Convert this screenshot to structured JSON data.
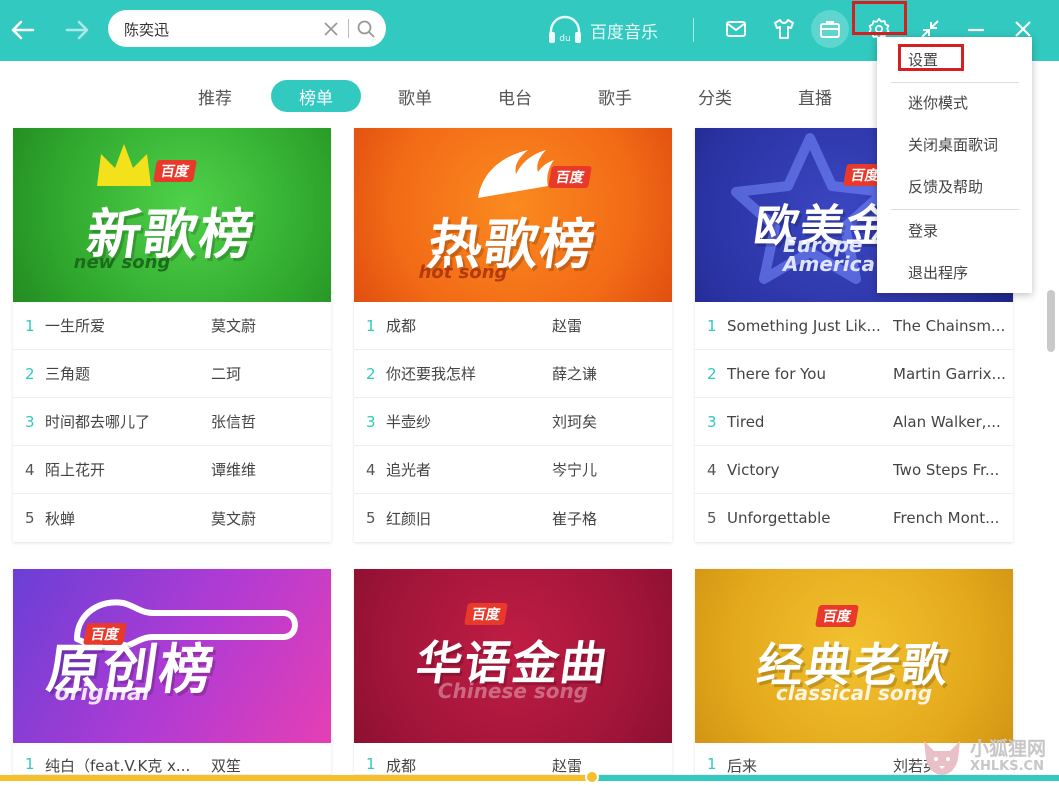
{
  "colors": {
    "accent": "#31c9c0",
    "highlight": "#d42020",
    "progress": "#f6c02c"
  },
  "search": {
    "value": "陈奕迅"
  },
  "header": {
    "brand": "百度音乐"
  },
  "tabs": [
    {
      "label": "推荐"
    },
    {
      "label": "榜单"
    },
    {
      "label": "歌单"
    },
    {
      "label": "电台"
    },
    {
      "label": "歌手"
    },
    {
      "label": "分类"
    },
    {
      "label": "直播"
    }
  ],
  "active_tab": "榜单",
  "charts": [
    {
      "badge": "百度",
      "name": "新歌榜",
      "subtitle": "new song",
      "songs": [
        {
          "rank": "1",
          "title": "一生所爱",
          "artist": "莫文蔚"
        },
        {
          "rank": "2",
          "title": "三角题",
          "artist": "二珂"
        },
        {
          "rank": "3",
          "title": "时间都去哪儿了",
          "artist": "张信哲"
        },
        {
          "rank": "4",
          "title": "陌上花开",
          "artist": "谭维维"
        },
        {
          "rank": "5",
          "title": "秋蝉",
          "artist": "莫文蔚"
        }
      ]
    },
    {
      "badge": "百度",
      "name": "热歌榜",
      "subtitle": "hot song",
      "songs": [
        {
          "rank": "1",
          "title": "成都",
          "artist": "赵雷"
        },
        {
          "rank": "2",
          "title": "你还要我怎样",
          "artist": "薛之谦"
        },
        {
          "rank": "3",
          "title": "半壶纱",
          "artist": "刘珂矣"
        },
        {
          "rank": "4",
          "title": "追光者",
          "artist": "岑宁儿"
        },
        {
          "rank": "5",
          "title": "红颜旧",
          "artist": "崔子格"
        }
      ]
    },
    {
      "badge": "百度",
      "name": "欧美金",
      "subtitle": "Europe America",
      "songs": [
        {
          "rank": "1",
          "title": "Something Just Lik...",
          "artist": "The Chainsm..."
        },
        {
          "rank": "2",
          "title": "There for You",
          "artist": "Martin Garrix..."
        },
        {
          "rank": "3",
          "title": "Tired",
          "artist": "Alan Walker,..."
        },
        {
          "rank": "4",
          "title": "Victory",
          "artist": "Two Steps Fr..."
        },
        {
          "rank": "5",
          "title": "Unforgettable",
          "artist": "French Mont..."
        }
      ]
    },
    {
      "badge": "百度",
      "name": "原创榜",
      "subtitle": "original",
      "songs": [
        {
          "rank": "1",
          "title": "纯白（feat.V.K克 x...",
          "artist": "双笙"
        }
      ]
    },
    {
      "badge": "百度",
      "name": "华语金曲",
      "subtitle": "Chinese song",
      "songs": [
        {
          "rank": "1",
          "title": "成都",
          "artist": "赵雷"
        }
      ]
    },
    {
      "badge": "百度",
      "name": "经典老歌",
      "subtitle": "classical song",
      "songs": [
        {
          "rank": "1",
          "title": "后来",
          "artist": "刘若英"
        }
      ]
    }
  ],
  "menu": {
    "items": [
      {
        "label": "设置"
      },
      {
        "label": "迷你模式"
      },
      {
        "label": "关闭桌面歌词"
      },
      {
        "label": "反馈及帮助"
      },
      {
        "label": "登录"
      },
      {
        "label": "退出程序"
      }
    ]
  },
  "watermark": {
    "line1": "小狐狸网",
    "line2": "XHLKS.CN"
  }
}
